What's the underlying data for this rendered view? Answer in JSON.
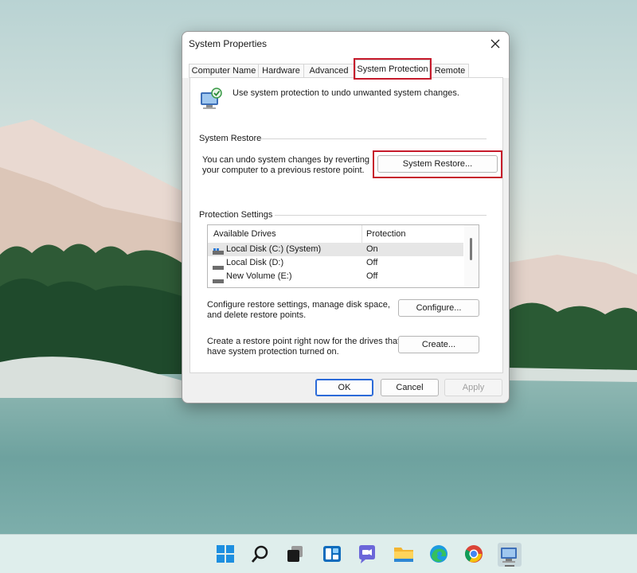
{
  "window": {
    "title": "System Properties"
  },
  "tabs": [
    {
      "label": "Computer Name"
    },
    {
      "label": "Hardware"
    },
    {
      "label": "Advanced"
    },
    {
      "label": "System Protection"
    },
    {
      "label": "Remote"
    }
  ],
  "intro": {
    "text": "Use system protection to undo unwanted system changes."
  },
  "system_restore": {
    "heading": "System Restore",
    "description_line1": "You can undo system changes by reverting",
    "description_line2": "your computer to a previous restore point.",
    "button": "System Restore..."
  },
  "protection": {
    "heading": "Protection Settings",
    "columns": [
      "Available Drives",
      "Protection"
    ],
    "drives": [
      {
        "name": "Local Disk (C:) (System)",
        "status": "On"
      },
      {
        "name": "Local Disk (D:)",
        "status": "Off"
      },
      {
        "name": "New Volume (E:)",
        "status": "Off"
      }
    ],
    "configure_text_line1": "Configure restore settings, manage disk space,",
    "configure_text_line2": "and delete restore points.",
    "configure_button": "Configure...",
    "create_text_line1": "Create a restore point right now for the drives that",
    "create_text_line2": "have system protection turned on.",
    "create_button": "Create..."
  },
  "footer": {
    "ok": "OK",
    "cancel": "Cancel",
    "apply": "Apply"
  },
  "taskbar": {
    "icons": [
      "windows-start-icon",
      "search-icon",
      "task-view-icon",
      "widgets-icon",
      "teams-chat-icon",
      "file-explorer-icon",
      "edge-icon",
      "chrome-icon",
      "system-properties-app-icon"
    ]
  },
  "colors": {
    "highlight": "#c61a2b",
    "accent": "#2b6ad8"
  }
}
